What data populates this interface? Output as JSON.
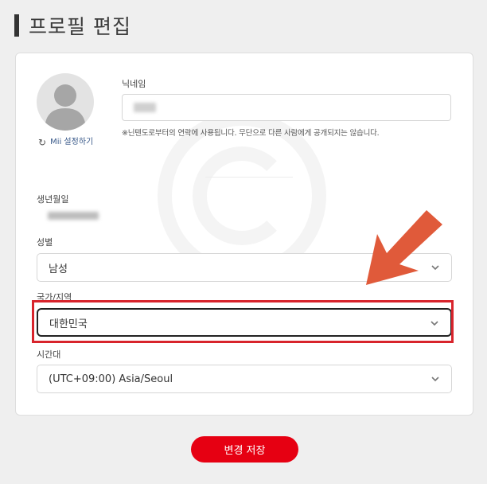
{
  "page": {
    "title": "프로필 편집"
  },
  "profile": {
    "mii_link_label": "Mii 설정하기",
    "nickname": {
      "label": "닉네임",
      "note": "※닌텐도로부터의 연락에 사용됩니다. 무단으로 다른 사람에게 공개되지는 않습니다."
    },
    "birthdate": {
      "label": "생년월일"
    },
    "gender": {
      "label": "성별",
      "value": "남성"
    },
    "country": {
      "label": "국가/지역",
      "value": "대한민국"
    },
    "timezone": {
      "label": "시간대",
      "value": "(UTC+09:00) Asia/Seoul"
    }
  },
  "actions": {
    "save_label": "변경 저장"
  },
  "colors": {
    "highlight": "#d8242c",
    "arrow": "#e05a3a",
    "save_button": "#e60012"
  },
  "icons": {
    "avatar": "avatar-icon",
    "refresh": "refresh-icon",
    "chevron": "chevron-down-icon",
    "arrow": "arrow-annotation-icon"
  }
}
